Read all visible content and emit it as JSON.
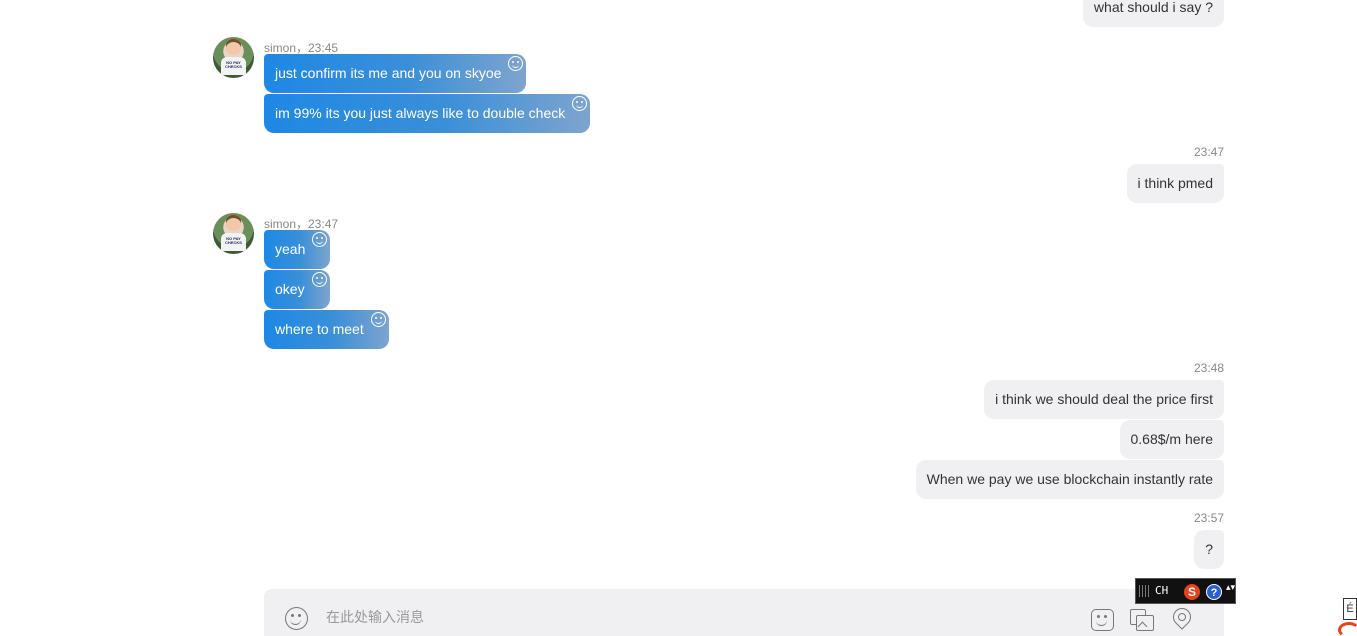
{
  "contact": {
    "name": "simon",
    "avatar_text": "NO PAY CHECKS"
  },
  "messages": {
    "out0": {
      "text": "what should i say ?"
    },
    "group1": {
      "meta": "simon，23:45",
      "bubbles": [
        "just confirm its me and you on skyoe",
        "im 99% its you just always like to double check"
      ]
    },
    "time2": "23:47",
    "out2": {
      "text": "i think pmed"
    },
    "group3": {
      "meta": "simon，23:47",
      "bubbles": [
        "yeah",
        "okey",
        "where to meet"
      ]
    },
    "time4": "23:48",
    "out4": [
      "i think we should deal the price first",
      "0.68$/m here",
      "When we pay we use blockchain instantly rate"
    ],
    "time5": "23:57",
    "out5": {
      "text": "?"
    }
  },
  "composer": {
    "placeholder": "在此处输入消息"
  },
  "ime": {
    "lang": "CH",
    "logo": "S",
    "help": "?",
    "menu": "▴▾"
  },
  "corner_widget": {
    "text": "É"
  },
  "icons": {
    "react": "smile-react-icon",
    "emoji": "emoji-icon",
    "sticker": "sticker-icon",
    "image": "image-icon",
    "location": "location-icon"
  },
  "colors": {
    "incoming_start": "#1e88e5",
    "incoming_end": "#7ea4cf",
    "outgoing_bg": "#f0f0f2",
    "composer_bg": "#f0f0f2"
  }
}
